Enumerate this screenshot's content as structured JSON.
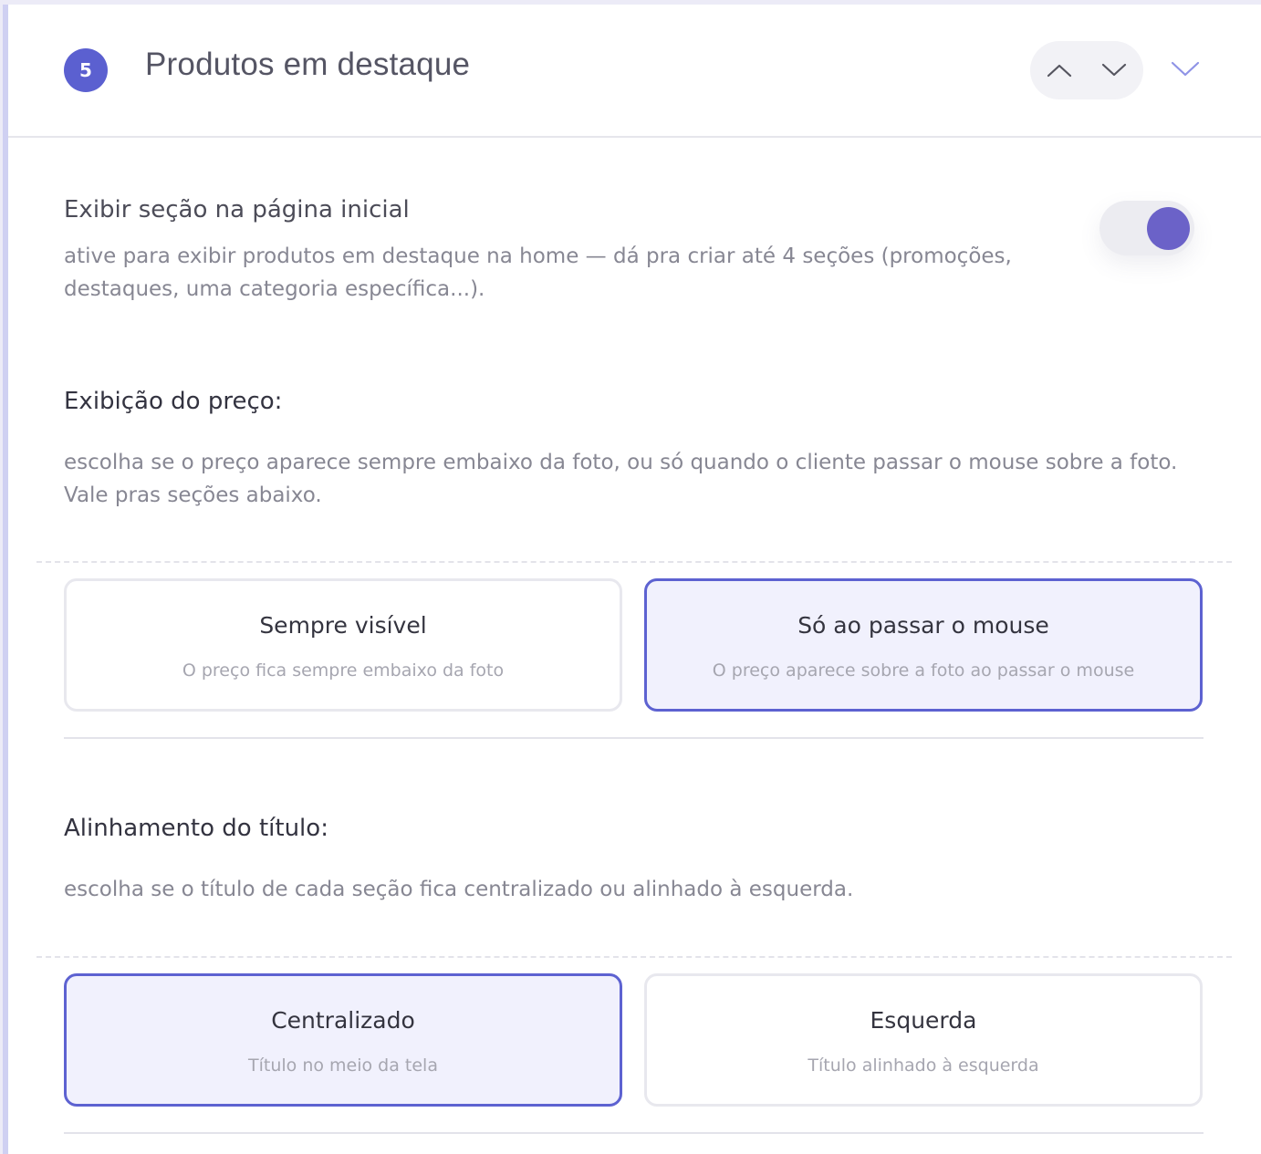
{
  "section": {
    "number": "5",
    "title": "Produtos em destaque",
    "move_up_icon": "chevron-up-icon",
    "move_down_icon": "chevron-down-icon",
    "collapse_icon": "chevron-down-icon"
  },
  "show_section": {
    "label": "Exibir seção na página inicial",
    "description": "ative para exibir produtos em destaque na home — dá pra criar até 4 seções (promoções, destaques, uma categoria específica...).",
    "enabled": true
  },
  "price_display": {
    "label": "Exibição do preço:",
    "description": "escolha se o preço aparece sempre embaixo da foto, ou só quando o cliente passar o mouse sobre a foto. Vale pras seções abaixo.",
    "options": [
      {
        "title": "Sempre visível",
        "subtitle": "O preço fica sempre embaixo da foto",
        "selected": false
      },
      {
        "title": "Só ao passar o mouse",
        "subtitle": "O preço aparece sobre a foto ao passar o mouse",
        "selected": true
      }
    ]
  },
  "title_alignment": {
    "label": "Alinhamento do título:",
    "description": "escolha se o título de cada seção fica centralizado ou alinhado à esquerda.",
    "options": [
      {
        "title": "Centralizado",
        "subtitle": "Título no meio da tela",
        "selected": true
      },
      {
        "title": "Esquerda",
        "subtitle": "Título alinhado à esquerda",
        "selected": false
      }
    ]
  },
  "colors": {
    "accent": "#5b60d0",
    "toggle_knob": "#6b62c8",
    "selected_bg": "#f1f1fd"
  }
}
